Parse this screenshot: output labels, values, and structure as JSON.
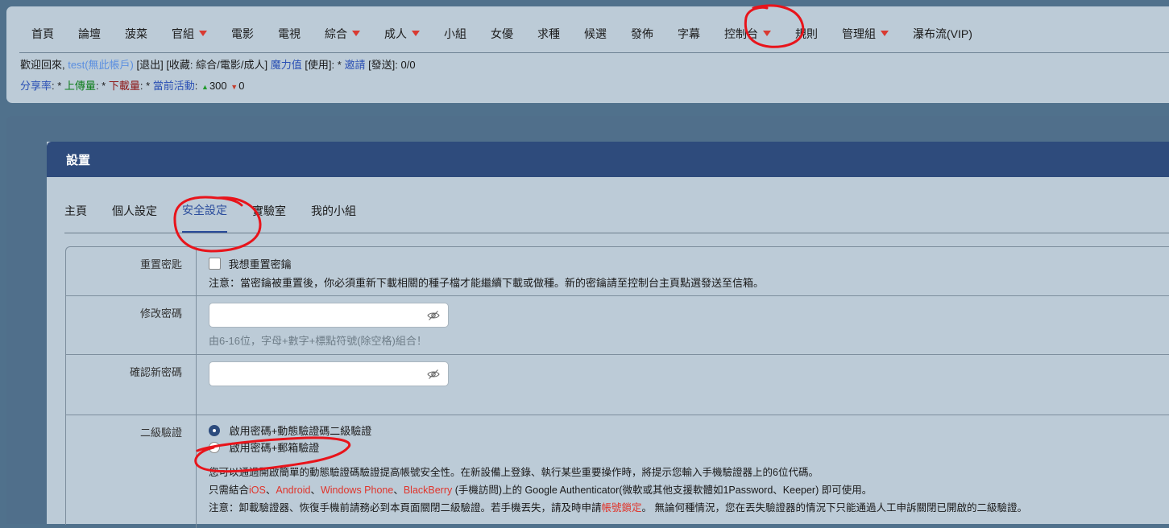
{
  "nav": {
    "items": [
      {
        "label": "首頁",
        "dropdown": false
      },
      {
        "label": "論壇",
        "dropdown": false
      },
      {
        "label": "菠菜",
        "dropdown": false
      },
      {
        "label": "官組",
        "dropdown": true
      },
      {
        "label": "電影",
        "dropdown": false
      },
      {
        "label": "電視",
        "dropdown": false
      },
      {
        "label": "綜合",
        "dropdown": true
      },
      {
        "label": "成人",
        "dropdown": true
      },
      {
        "label": "小組",
        "dropdown": false
      },
      {
        "label": "女優",
        "dropdown": false
      },
      {
        "label": "求種",
        "dropdown": false
      },
      {
        "label": "候選",
        "dropdown": false
      },
      {
        "label": "發佈",
        "dropdown": false
      },
      {
        "label": "字幕",
        "dropdown": false
      },
      {
        "label": "控制台",
        "dropdown": true
      },
      {
        "label": "規則",
        "dropdown": false
      },
      {
        "label": "管理組",
        "dropdown": true
      },
      {
        "label": "瀑布流(VIP)",
        "dropdown": false
      }
    ]
  },
  "userbar": {
    "welcome": "歡迎回來, ",
    "username": "test(無此帳戶)",
    "logout": " [退出] ",
    "favorites_prefix": "[收藏: ",
    "fav_comprehensive": "綜合",
    "fav_sep1": "/",
    "fav_movie": "電影",
    "fav_sep2": "/",
    "fav_adult": "成人",
    "favorites_suffix": "] ",
    "bonus_label": "魔力值",
    "bonus_value": " [使用]: * ",
    "invite_label": "邀請",
    "invite_value": " [發送]: 0/0",
    "ratio_label": "分享率",
    "ratio_value": ": * ",
    "upload_label": "上傳量",
    "upload_value": ": * ",
    "download_label": "下載量",
    "download_value": ": * ",
    "active_label": "當前活動",
    "active_sep": ": ",
    "seeding_count": "300",
    "leeching_count": "0"
  },
  "panel": {
    "title": "設置",
    "tabs": [
      {
        "label": "主頁",
        "active": false
      },
      {
        "label": "個人設定",
        "active": false
      },
      {
        "label": "安全設定",
        "active": true
      },
      {
        "label": "實驗室",
        "active": false
      },
      {
        "label": "我的小組",
        "active": false
      }
    ]
  },
  "security": {
    "reset_passkey": {
      "label": "重置密匙",
      "checkbox_label": "我想重置密鑰",
      "note": "注意：當密鑰被重置後，你必須重新下載相關的種子檔才能繼續下載或做種。新的密鑰請至控制台主頁點選發送至信箱。"
    },
    "change_password": {
      "label": "修改密碼",
      "value": "",
      "hint": "由6-16位，字母+數字+標點符號(除空格)組合！"
    },
    "confirm_password": {
      "label": "確認新密碼",
      "value": ""
    },
    "two_factor": {
      "label": "二級驗證",
      "option1": "啟用密碼+動態驗證碼二級驗證",
      "option2": "啟用密碼+郵箱驗證",
      "selected": "option1",
      "desc1": "您可以通過開啟簡單的動態驗證碼驗證提高帳號安全性。在新設備上登錄、執行某些重要操作時，將提示您輸入手機驗證器上的6位代碼。",
      "desc2_prefix": "只需結合",
      "platform_ios": "iOS",
      "platform_sep1": "、",
      "platform_android": "Android",
      "platform_sep2": "、",
      "platform_wp": "Windows Phone",
      "platform_sep3": "、",
      "platform_bb": "BlackBerry",
      "desc2_suffix": " (手機訪問)上的 Google Authenticator(微軟或其他支援軟體如1Password、Keeper) 即可使用。",
      "desc3_prefix": "注意：卸載驗證器、恢復手機前請務必到本頁面關閉二級驗證。若手機丟失，請及時申請",
      "desc3_link": "帳號鎖定",
      "desc3_suffix": "。 無論何種情況，您在丟失驗證器的情況下只能通過人工申訴關閉已開啟的二級驗證。"
    }
  },
  "colors": {
    "page_bg": "#50718c",
    "panel_bg": "#bccbd7",
    "header_bg": "#2e4b7c",
    "link_blue": "#2b50b4",
    "dropdown_caret": "#d93a32",
    "annotation_red": "#e8141b"
  },
  "icons": {
    "password_toggle": "eye-off-icon",
    "dropdown": "caret-down-icon",
    "seeding": "arrow-up-icon",
    "leeching": "arrow-down-icon"
  }
}
